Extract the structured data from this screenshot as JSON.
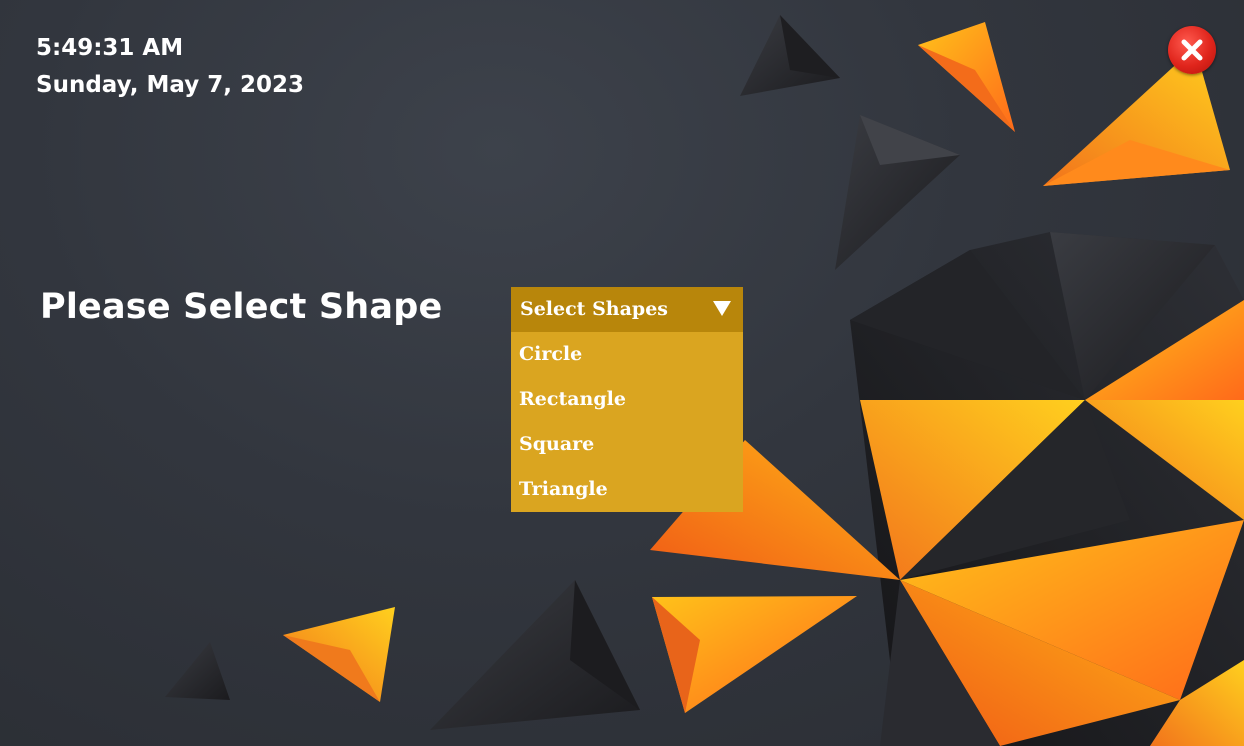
{
  "clock": {
    "time": "5:49:31 AM",
    "date": "Sunday, May 7, 2023"
  },
  "prompt": {
    "label": "Please Select Shape"
  },
  "dropdown": {
    "selected": "Select Shapes",
    "options": [
      "Circle",
      "Rectangle",
      "Square",
      "Triangle"
    ]
  },
  "icons": {
    "close": "close-icon",
    "dropdown_arrow": "caret-down-icon"
  },
  "colors": {
    "dropdown_header": "#b8860b",
    "dropdown_list": "#daa520",
    "close_button": "#e0251c",
    "accent_orange": "#ff8c1a"
  }
}
